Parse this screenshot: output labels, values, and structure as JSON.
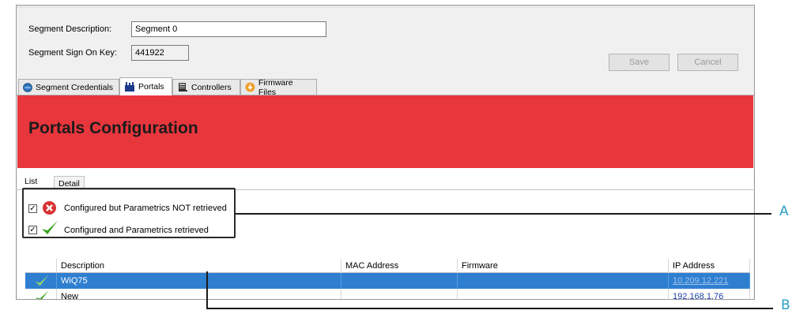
{
  "segment": {
    "description_label": "Segment Description:",
    "description_value": "Segment 0",
    "sign_on_key_label": "Segment Sign On Key:",
    "sign_on_key_value": "441922"
  },
  "actions": {
    "save_label": "Save",
    "cancel_label": "Cancel"
  },
  "tabs": [
    {
      "label": "Segment Credentials",
      "icon": "globe-icon"
    },
    {
      "label": "Portals",
      "icon": "portal-icon",
      "active": true
    },
    {
      "label": "Controllers",
      "icon": "controller-icon"
    },
    {
      "label": "Firmware Files",
      "icon": "firmware-icon"
    }
  ],
  "banner": {
    "title": "Portals Configuration",
    "color": "#e8363d"
  },
  "subtabs": [
    {
      "label": "List",
      "active": true
    },
    {
      "label": "Detail"
    }
  ],
  "legend": [
    {
      "checked": true,
      "icon": "error-x-icon",
      "text": "Configured but Parametrics NOT retrieved"
    },
    {
      "checked": true,
      "icon": "green-check-icon",
      "text": "Configured and Parametrics retrieved"
    }
  ],
  "table": {
    "columns": [
      "Description",
      "MAC Address",
      "Firmware",
      "IP Address"
    ],
    "rows": [
      {
        "status_icon": "green-check-icon",
        "description": "WiQ75",
        "mac": "",
        "firmware": "",
        "ip": "10.209.12.221",
        "selected": true
      },
      {
        "status_icon": "green-check-icon",
        "description": "New",
        "mac": "",
        "firmware": "",
        "ip": "192.168.1.76",
        "selected": false
      }
    ]
  },
  "callouts": {
    "a": "A",
    "b": "B"
  },
  "colors": {
    "accent": "#2aa0c8",
    "selection": "#2f7fd1",
    "check": "#3aa51b",
    "error": "#d93232"
  }
}
